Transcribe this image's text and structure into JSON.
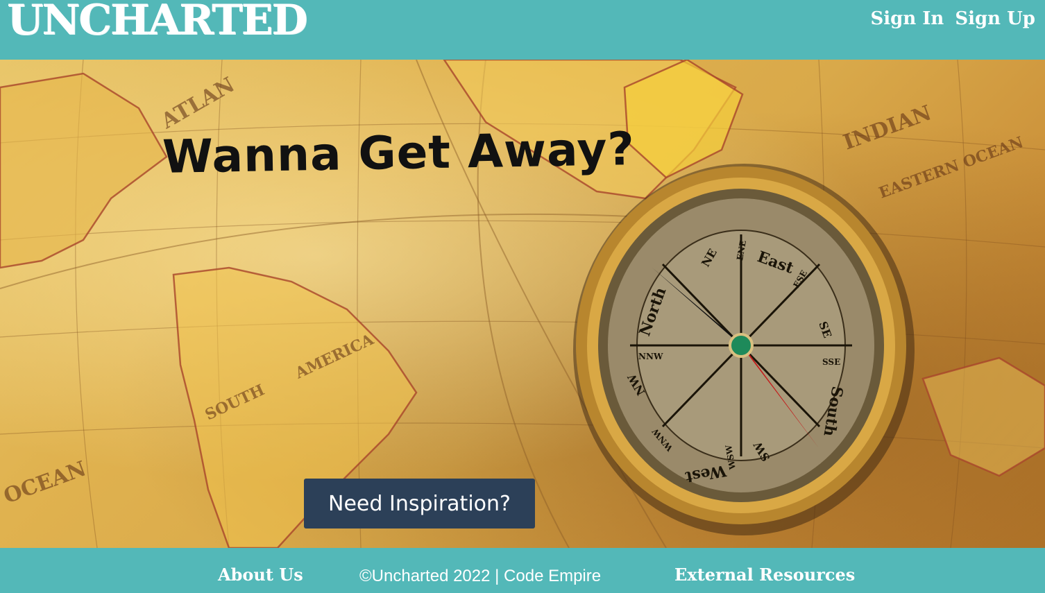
{
  "header": {
    "logo": "UNCHARTED",
    "nav": {
      "sign_in": "Sign In",
      "sign_up": "Sign Up"
    }
  },
  "hero": {
    "headline": "Wanna Get Away?",
    "cta_label": "Need Inspiration?",
    "background_image": "antique world map with brass compass",
    "compass_labels": [
      "North",
      "NE",
      "ENE",
      "East",
      "ESE",
      "SE",
      "SSE",
      "South",
      "SW",
      "WSW",
      "West",
      "WNW",
      "NW",
      "NNW"
    ],
    "map_labels": [
      "ATLAN",
      "OCEAN",
      "INDIAN",
      "EASTERN OCEAN",
      "AMERICA",
      "SOUTH"
    ]
  },
  "footer": {
    "about": "About Us",
    "copyright": "©Uncharted 2022 | Code Empire",
    "external": "External Resources"
  },
  "colors": {
    "header_bg": "#53b8b8",
    "cta_bg": "#2c4058",
    "text_light": "#ffffff",
    "headline": "#111111"
  }
}
